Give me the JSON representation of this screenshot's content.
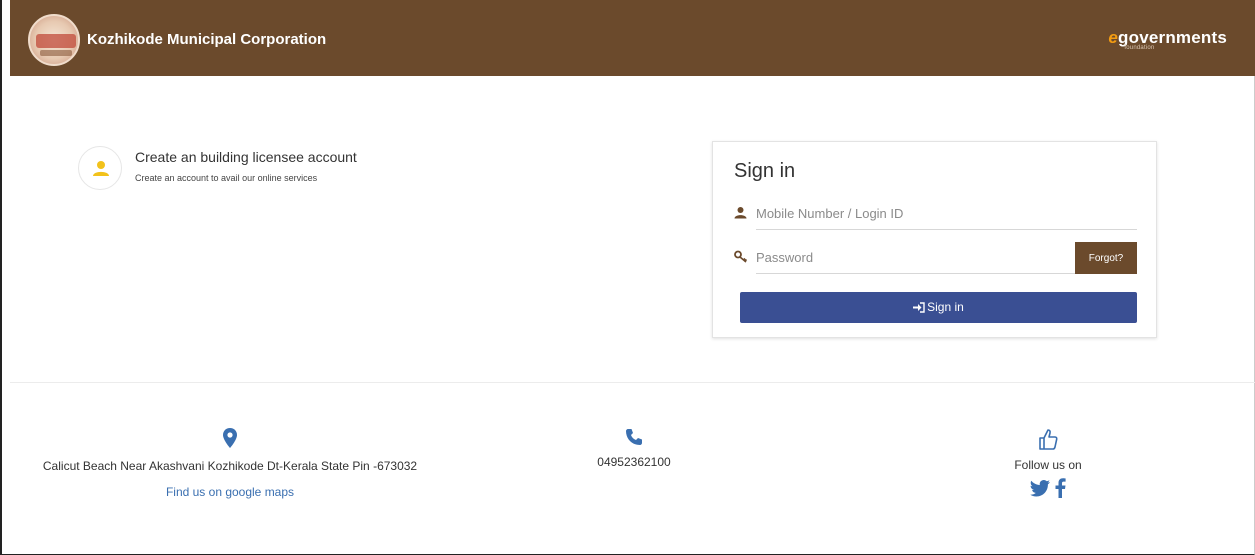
{
  "header": {
    "org_name": "Kozhikode Municipal Corporation",
    "brand_e": "e",
    "brand_rest": "governments",
    "brand_sub": "foundation",
    "bg_color": "#6b4a2c"
  },
  "create_account": {
    "title": "Create an building licensee account",
    "subtitle": "Create an account to avail our online services",
    "icon": "user-icon"
  },
  "signin": {
    "title": "Sign in",
    "login_placeholder": "Mobile Number / Login ID",
    "password_placeholder": "Password",
    "forgot_label": "Forgot?",
    "button_label": "Sign in",
    "button_color": "#3a4f93"
  },
  "footer": {
    "address": "Calicut Beach Near Akashvani Kozhikode Dt-Kerala State Pin -673032",
    "maps_link": "Find us on google maps",
    "phone": "04952362100",
    "follow_label": "Follow us on",
    "accent_color": "#3a6fb0"
  }
}
